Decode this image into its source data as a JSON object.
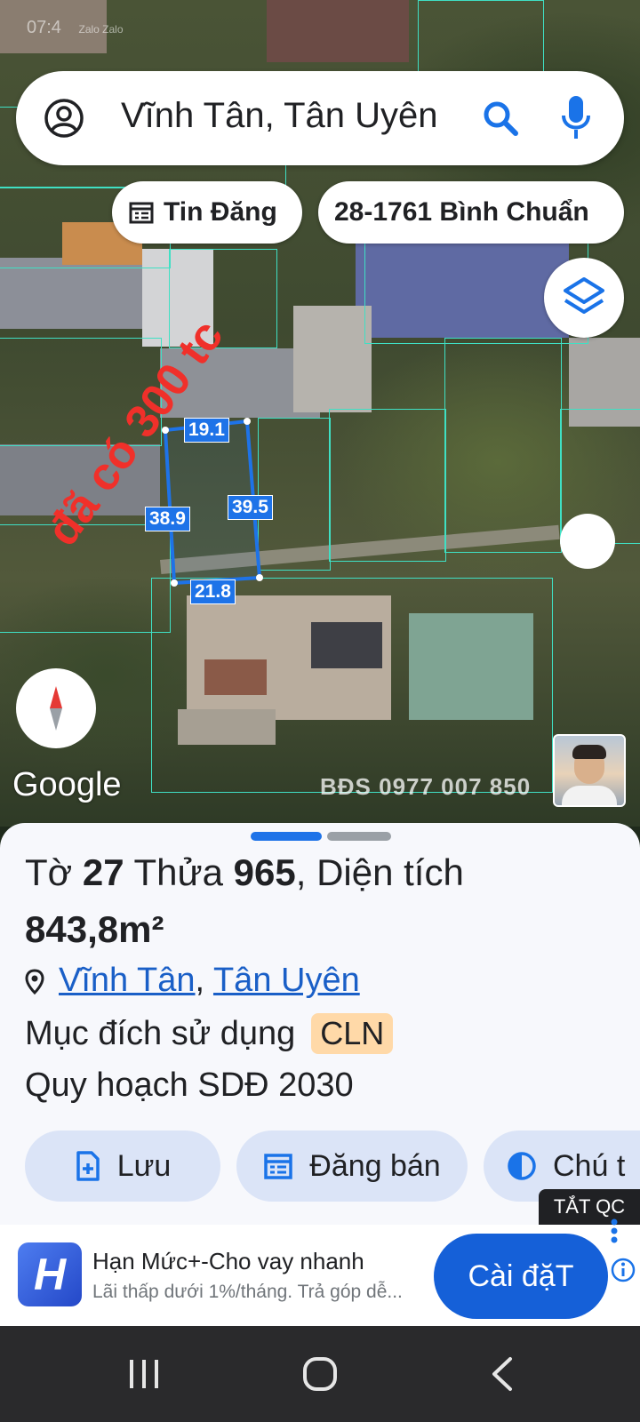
{
  "status_bar": {
    "time": "07:4",
    "apps": "Zalo Zalo"
  },
  "search": {
    "query": "Vĩnh Tân, Tân Uyên"
  },
  "chips": {
    "listing_label": "Tin Đăng",
    "listing_icon": "calendar-list-icon",
    "agent_label": "28-1761 Bình Chuẩn"
  },
  "map": {
    "dimensions": {
      "top": "19.1",
      "left": "38.9",
      "right": "39.5",
      "bottom": "21.8"
    },
    "overlay_text": "đã có 300 tc",
    "google_logo": "Google",
    "watermark": "BĐS 0977 007 850",
    "parcel_line_color": "#3fe0c4",
    "dimension_color": "#1e73e8"
  },
  "sheet": {
    "title_prefix": "Tờ ",
    "sheet_no": "27",
    "title_mid": " Thửa ",
    "parcel_no": "965",
    "title_suffix": ", Diện tích",
    "area": "843,8m²",
    "location_1": "Vĩnh Tân",
    "location_sep": ", ",
    "location_2": "Tân Uyên",
    "purpose_label": "Mục đích sử dụng",
    "purpose_code": "CLN",
    "planning": "Quy hoạch SDĐ 2030",
    "actions": [
      {
        "label": "Lưu",
        "icon": "add-file-icon"
      },
      {
        "label": "Đăng bán",
        "icon": "calendar-list-icon"
      },
      {
        "label": "Chú t",
        "icon": "contrast-icon"
      }
    ]
  },
  "ad": {
    "hide_label": "TẮT QC",
    "logo_letter": "H",
    "headline": "Hạn Mức+-Cho vay nhanh",
    "subtext": "Lãi thấp dưới 1%/tháng. Trả góp dễ...",
    "cta": "Cài đặT"
  },
  "colors": {
    "accent": "#1a73e8",
    "badge": "#ffd9a8",
    "sheet_bg": "#f7f8fc"
  }
}
